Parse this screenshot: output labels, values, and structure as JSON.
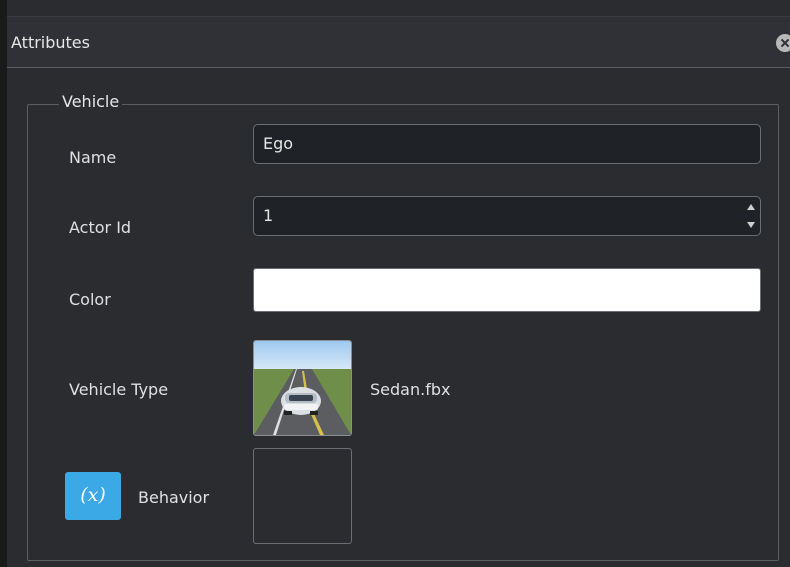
{
  "panel": {
    "title": "Attributes"
  },
  "group": {
    "title": "Vehicle"
  },
  "fields": {
    "name_label": "Name",
    "name_value": "Ego",
    "actor_id_label": "Actor Id",
    "actor_id_value": "1",
    "color_label": "Color",
    "color_value": "#ffffff",
    "vehicle_type_label": "Vehicle Type",
    "vehicle_type_value": "Sedan.fbx",
    "behavior_label": "Behavior",
    "behavior_button_text": "(x)"
  },
  "icons": {
    "close": "close-circle-icon",
    "behavior": "variable-icon",
    "vehicle_thumbnail": "sedan-thumbnail"
  },
  "colors": {
    "accent": "#3aa9e6",
    "background": "#2a2c30"
  }
}
